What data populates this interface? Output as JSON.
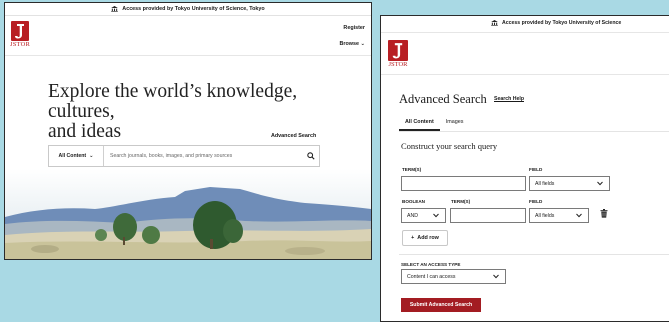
{
  "left": {
    "access_text": "Access provided by Tokyo University of Science, Tokyo",
    "logo_text": "JSTOR",
    "register": "Register",
    "browse": "Browse",
    "hero_title_line1": "Explore the world’s knowledge, cultures,",
    "hero_title_line2": "and ideas",
    "advanced_search": "Advanced Search",
    "scope_selected": "All Content",
    "search_placeholder": "Search journals, books, images, and primary sources"
  },
  "right": {
    "access_text": "Access provided by Tokyo University of Science",
    "logo_text": "JSTOR",
    "title": "Advanced Search",
    "search_help": "Search Help",
    "tabs": [
      "All Content",
      "Images"
    ],
    "construct_heading": "Construct your search query",
    "row1": {
      "term_label": "TERM(S)",
      "field_label": "FIELD",
      "field_value": "All fields",
      "term_value": ""
    },
    "row2": {
      "boolean_label": "BOOLEAN",
      "boolean_value": "AND",
      "term_label": "TERM(S)",
      "field_label": "FIELD",
      "field_value": "All fields",
      "term_value": ""
    },
    "add_row": "Add row",
    "access_type_label": "SELECT AN ACCESS TYPE",
    "access_type_value": "Content I can access",
    "submit": "Submit Advanced Search"
  },
  "colors": {
    "jstor_red": "#b81f24",
    "submit_red": "#a31c22",
    "background": "#a9d9e4"
  }
}
